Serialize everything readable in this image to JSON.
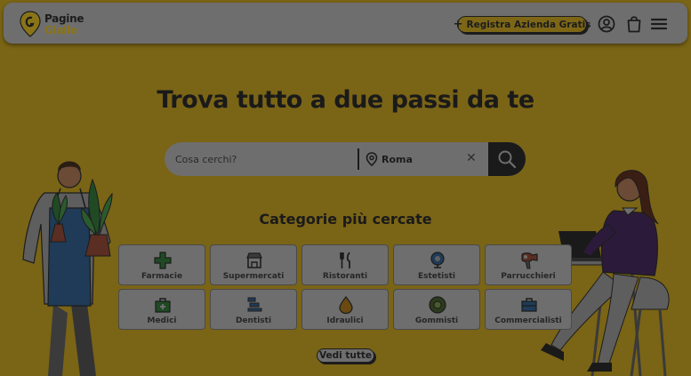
{
  "header": {
    "logo_line1": "Pagine",
    "logo_line2": "Gialle",
    "register_label": "Registra Azienda Gratis",
    "register_icon": "plus-icon",
    "icons": [
      "user-icon",
      "shopping-bag-icon",
      "menu-icon"
    ]
  },
  "hero": {
    "title": "Trova tutto a due passi da te"
  },
  "search": {
    "what_placeholder": "Cosa cerchi?",
    "where_value": "Roma",
    "where_icon": "location-pin-icon",
    "clear_icon": "close-icon",
    "submit_icon": "search-icon"
  },
  "categories": {
    "title": "Categorie più cercate",
    "items": [
      {
        "label": "Farmacie",
        "icon": "pharmacy-cross-icon"
      },
      {
        "label": "Supermercati",
        "icon": "store-icon"
      },
      {
        "label": "Ristoranti",
        "icon": "fork-knife-icon"
      },
      {
        "label": "Estetisti",
        "icon": "beauty-icon"
      },
      {
        "label": "Parrucchieri",
        "icon": "hairdryer-icon"
      },
      {
        "label": "Medici",
        "icon": "medical-bag-icon"
      },
      {
        "label": "Dentisti",
        "icon": "dental-chair-icon"
      },
      {
        "label": "Idraulici",
        "icon": "water-drop-icon"
      },
      {
        "label": "Gommisti",
        "icon": "tire-icon"
      },
      {
        "label": "Commercialisti",
        "icon": "briefcase-icon"
      }
    ],
    "see_all_label": "Vedi tutte"
  },
  "colors": {
    "overlay_background": "#7a6416",
    "brand_yellow": "#f5c800",
    "text_dark": "#1a1a1a"
  }
}
